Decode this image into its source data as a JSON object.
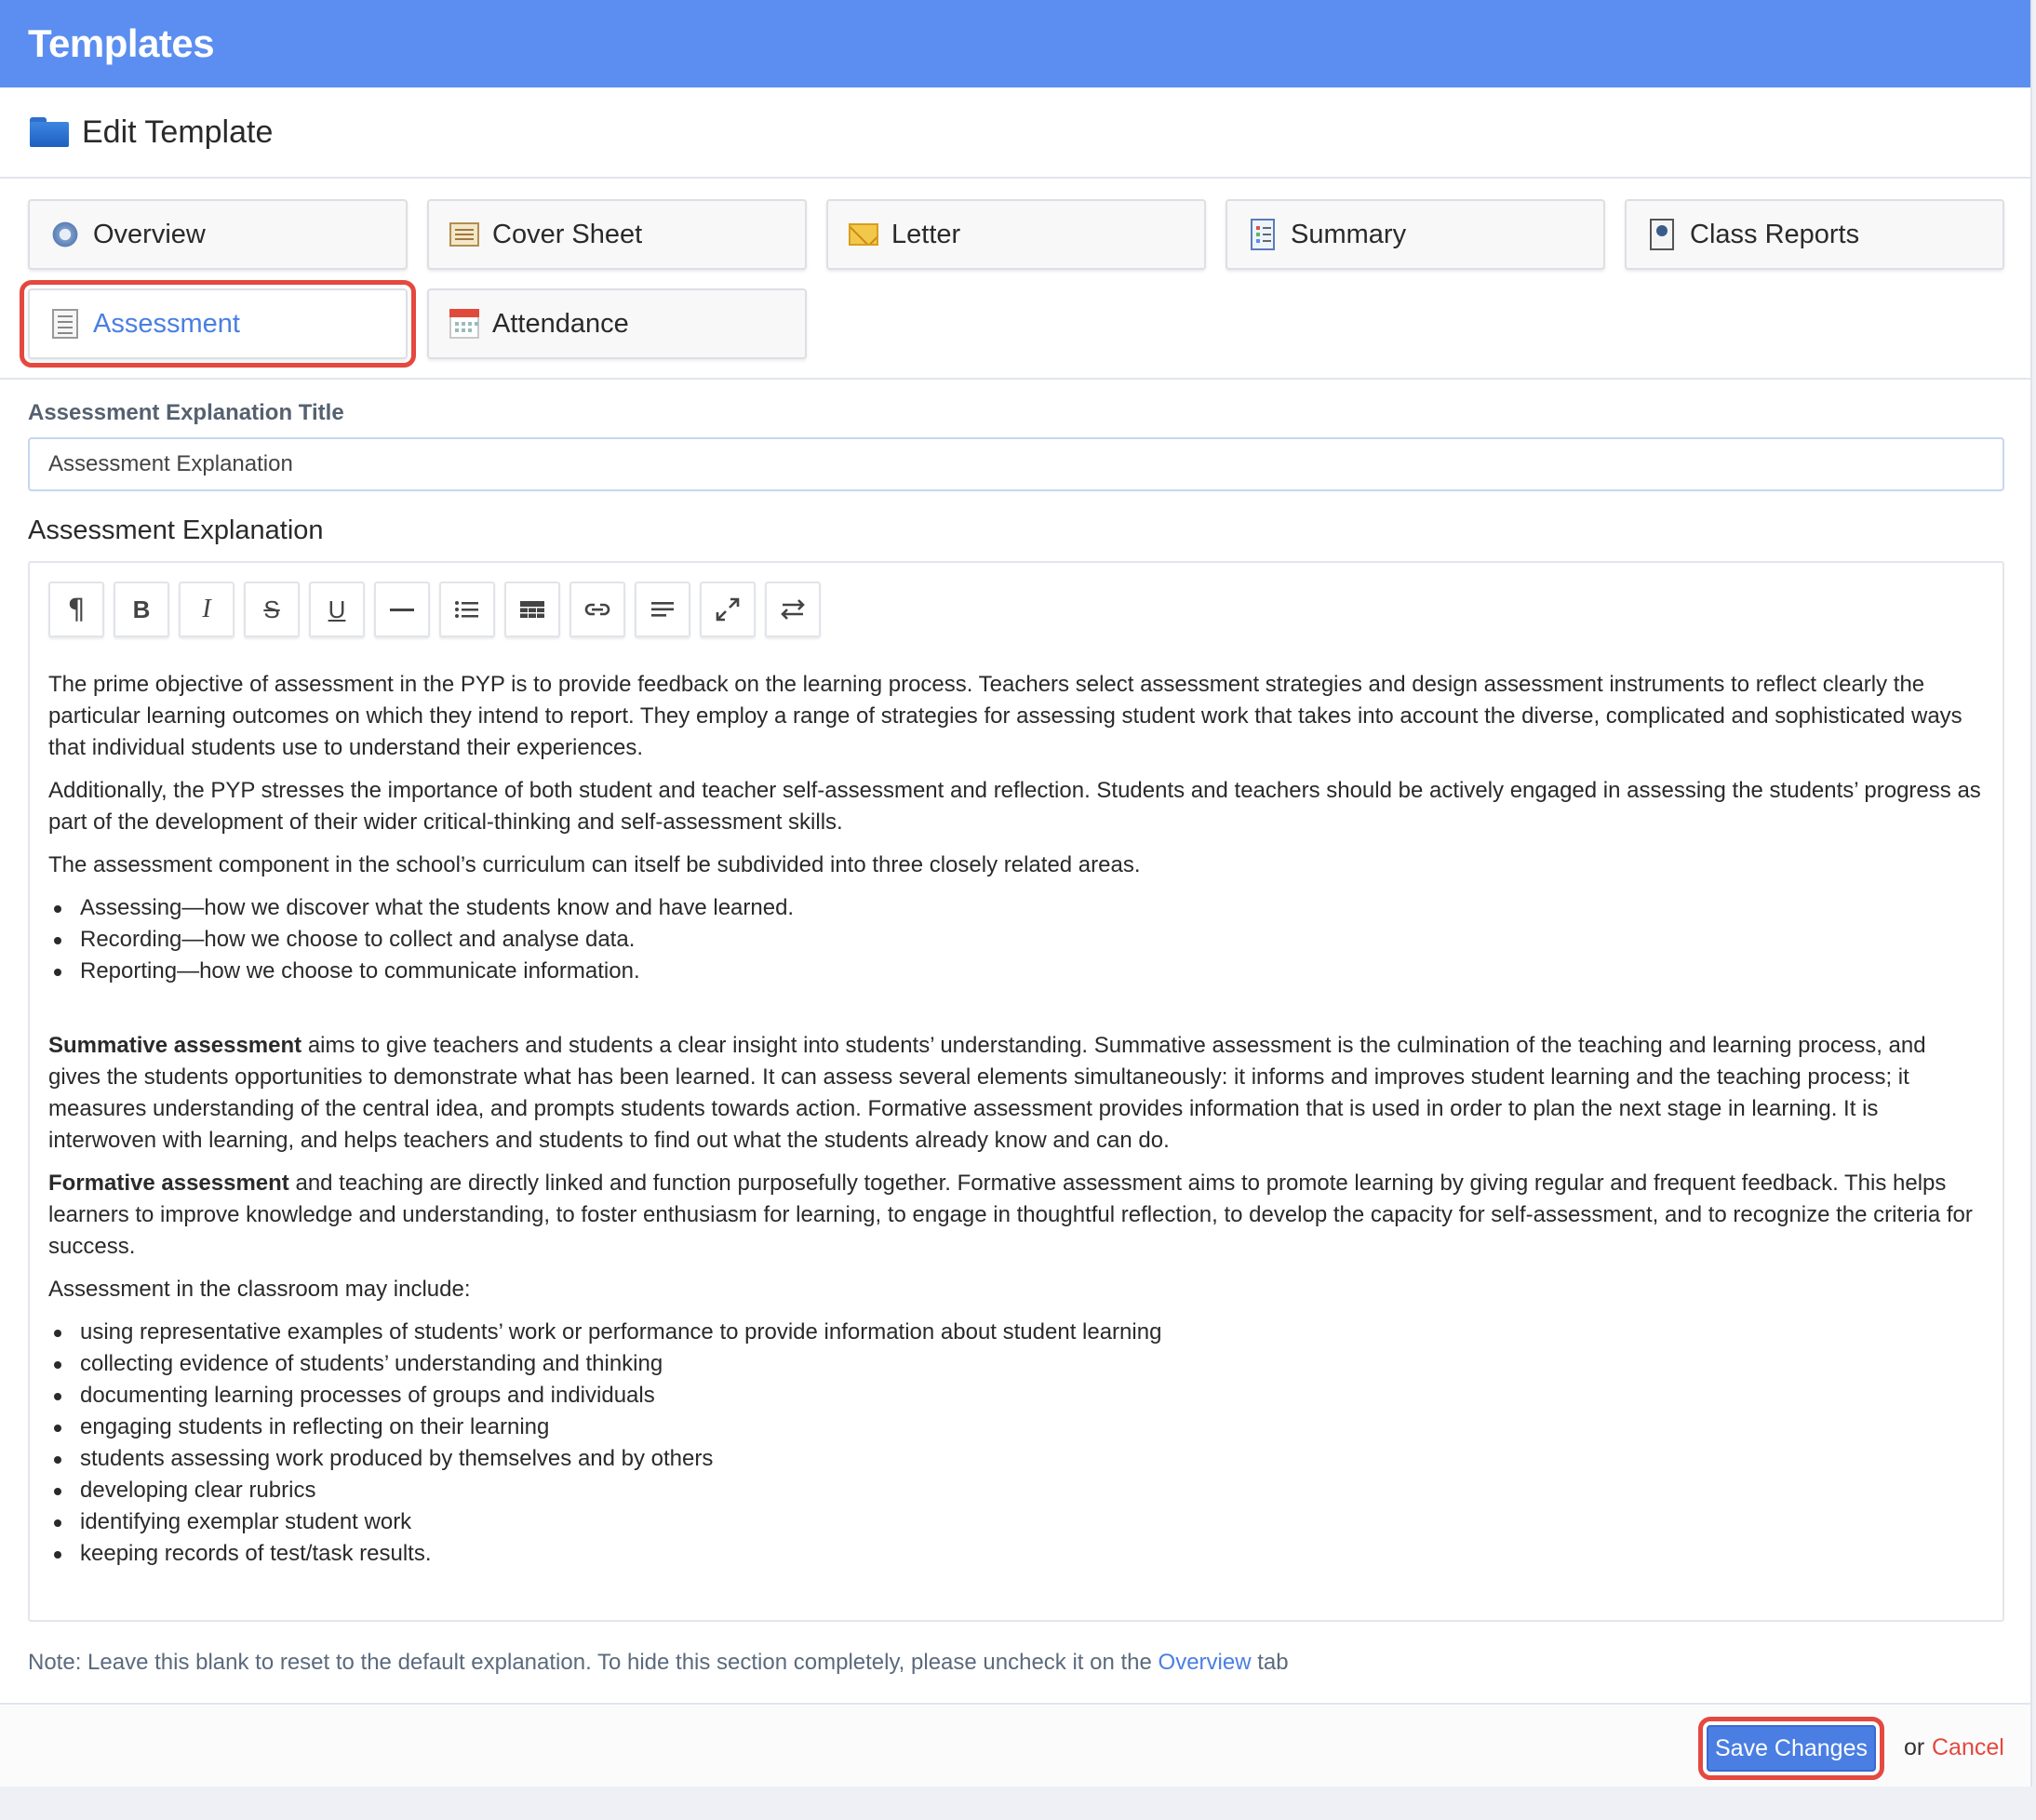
{
  "app": {
    "title": "Templates"
  },
  "header": {
    "title": "Edit Template",
    "icon": "folder-icon"
  },
  "tabs": [
    {
      "label": "Overview",
      "icon": "gear-icon",
      "active": false
    },
    {
      "label": "Cover Sheet",
      "icon": "cover-sheet-icon",
      "active": false
    },
    {
      "label": "Letter",
      "icon": "envelope-icon",
      "active": false
    },
    {
      "label": "Summary",
      "icon": "summary-icon",
      "active": false
    },
    {
      "label": "Class Reports",
      "icon": "class-reports-icon",
      "active": false
    },
    {
      "label": "Assessment",
      "icon": "assessment-icon",
      "active": true
    },
    {
      "label": "Attendance",
      "icon": "calendar-icon",
      "active": false
    }
  ],
  "form": {
    "title_label": "Assessment Explanation Title",
    "title_value": "Assessment Explanation",
    "explanation_label": "Assessment Explanation"
  },
  "toolbar": [
    {
      "name": "paragraph",
      "icon": "paragraph-icon"
    },
    {
      "name": "bold",
      "icon": "bold-icon"
    },
    {
      "name": "italic",
      "icon": "italic-icon"
    },
    {
      "name": "strikethrough",
      "icon": "strikethrough-icon"
    },
    {
      "name": "underline",
      "icon": "underline-icon"
    },
    {
      "name": "horizontal-rule",
      "icon": "horizontal-rule-icon"
    },
    {
      "name": "list",
      "icon": "list-icon"
    },
    {
      "name": "table",
      "icon": "table-icon"
    },
    {
      "name": "link",
      "icon": "link-icon"
    },
    {
      "name": "align",
      "icon": "align-icon"
    },
    {
      "name": "fullscreen",
      "icon": "expand-icon"
    },
    {
      "name": "html",
      "icon": "swap-icon"
    }
  ],
  "content": {
    "p1": "The prime objective of assessment in the PYP is to provide feedback on the learning process. Teachers select assessment strategies and design assessment instruments to reflect clearly the particular learning outcomes on which they intend to report. They employ a range of strategies for assessing student work that takes into account the diverse, complicated and sophisticated ways that individual students use to understand their experiences.",
    "p2": "Additionally, the PYP stresses the importance of both student and teacher self-assessment and reflection. Students and teachers should be actively engaged in assessing the students’ progress as part of the development of their wider critical-thinking and self-assessment skills.",
    "p3": "The assessment component in the school’s curriculum can itself be subdivided into three closely related areas.",
    "list1": [
      "Assessing—how we discover what the students know and have learned.",
      "Recording—how we choose to collect and analyse data.",
      "Reporting—how we choose to communicate information."
    ],
    "p4_bold": "Summative assessment",
    "p4_rest": " aims to give teachers and students a clear insight into students’ understanding. Summative assessment is the culmination of the teaching and learning process, and gives the students opportunities to demonstrate what has been learned. It can assess several elements simultaneously: it informs and improves student learning and the teaching process; it measures understanding of the central idea, and prompts students towards action. Formative assessment provides information that is used in order to plan the next stage in learning. It is interwoven with learning, and helps teachers and students to find out what the students already know and can do.",
    "p5_bold": "Formative assessment",
    "p5_rest": " and teaching are directly linked and function purposefully together. Formative assessment aims to promote learning by giving regular and frequent feedback. This helps learners to improve knowledge and understanding, to foster enthusiasm for learning, to engage in thoughtful reflection, to develop the capacity for self-assessment, and to recognize the criteria for success.",
    "p6": "Assessment in the classroom may include:",
    "list2": [
      "using representative examples of students’ work or performance to provide information about student learning",
      "collecting evidence of students’ understanding and thinking",
      "documenting learning processes of groups and individuals",
      "engaging students in reflecting on their learning",
      "students assessing work produced by themselves and by others",
      "developing clear rubrics",
      "identifying exemplar student work",
      "keeping records of test/task results."
    ]
  },
  "note": {
    "text_before": "Note: Leave this blank to reset to the default explanation. To hide this section completely, please uncheck it on the ",
    "link": "Overview",
    "text_after": " tab"
  },
  "footer": {
    "save_label": "Save Changes",
    "or_text": "or",
    "cancel_label": "Cancel"
  },
  "colors": {
    "topbar": "#5b8ef0",
    "accent": "#4a7ee3",
    "highlight": "#e5483f"
  }
}
